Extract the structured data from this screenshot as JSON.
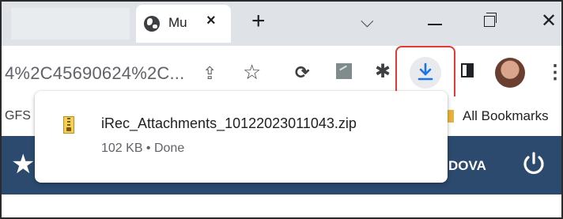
{
  "tab": {
    "title": "Mu",
    "close_glyph": "×",
    "new_tab_glyph": "+"
  },
  "window_controls": {
    "tab_search_glyph": "⌵",
    "close_glyph": "✕"
  },
  "toolbar": {
    "url": "4%2C45690624%2C...",
    "icons": [
      "share-icon",
      "star-icon",
      "sync-icon",
      "extension-icon",
      "puzzle-icon",
      "download-icon",
      "side-panel-icon",
      "avatar",
      "menu-icon"
    ]
  },
  "bookmarks": {
    "left_label": "GFS",
    "right_label": "All Bookmarks"
  },
  "page_header": {
    "user_name": "DOVA"
  },
  "download": {
    "file_name": "iRec_Attachments_10122023011043.zip",
    "meta": "102 KB • Done"
  },
  "colors": {
    "header_blue": "#2c4a6e",
    "download_blue": "#1a73e8",
    "highlight_red": "#e53935"
  }
}
